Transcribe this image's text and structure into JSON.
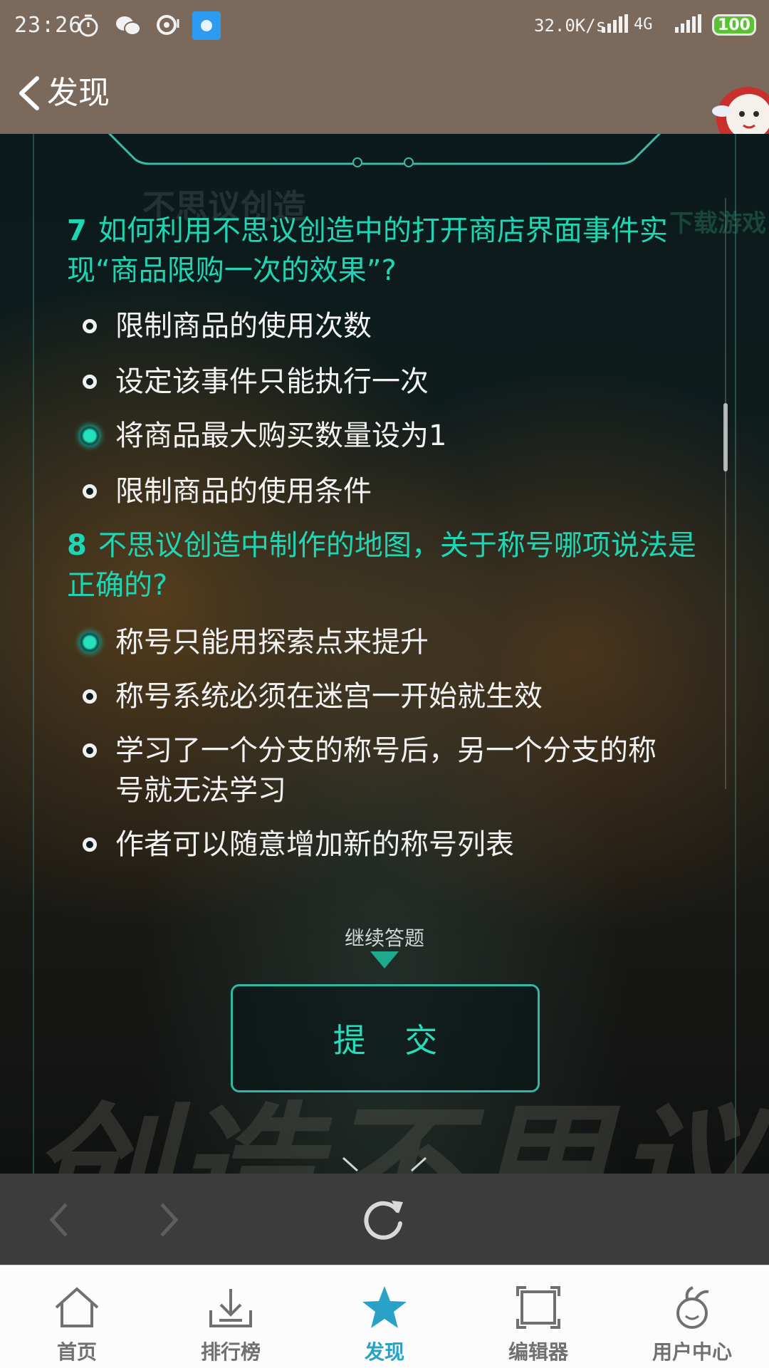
{
  "status_bar": {
    "time": "23:26",
    "net_speed": "32.0K/s",
    "network_type": "4G",
    "battery": "100",
    "icons": [
      "alarm-icon",
      "wechat-icon",
      "chat-bubble-icon",
      "app-notification-icon",
      "signal-icon",
      "battery-icon"
    ]
  },
  "header": {
    "back_icon": "chevron-left-icon",
    "title": "发现"
  },
  "questions": [
    {
      "number": "7",
      "text": "如何利用不思议创造中的打开商店界面事件实现“商品限购一次的效果”?",
      "options": [
        {
          "label": "限制商品的使用次数",
          "selected": false
        },
        {
          "label": "设定该事件只能执行一次",
          "selected": false
        },
        {
          "label": "将商品最大购买数量设为1",
          "selected": true
        },
        {
          "label": "限制商品的使用条件",
          "selected": false
        }
      ]
    },
    {
      "number": "8",
      "text": "不思议创造中制作的地图，关于称号哪项说法是正确的?",
      "options": [
        {
          "label": "称号只能用探索点来提升",
          "selected": true
        },
        {
          "label": "称号系统必须在迷宫一开始就生效",
          "selected": false
        },
        {
          "label": "学习了一个分支的称号后，另一个分支的称号就无法学习",
          "selected": false
        },
        {
          "label": "作者可以随意增加新的称号列表",
          "selected": false
        }
      ]
    }
  ],
  "continue_label": "继续答题",
  "submit_label": "提 交",
  "background_text": {
    "game_name": "不思议创造",
    "download": "下载游戏",
    "banner": "创造不思议"
  },
  "browser_bar": {
    "back_icon": "back-arrow-icon",
    "forward_icon": "forward-arrow-icon",
    "refresh_icon": "refresh-icon"
  },
  "tabs": [
    {
      "label": "首页",
      "icon": "home-icon",
      "active": false
    },
    {
      "label": "排行榜",
      "icon": "download-icon",
      "active": false
    },
    {
      "label": "发现",
      "icon": "star-icon",
      "active": true
    },
    {
      "label": "编辑器",
      "icon": "editor-frame-icon",
      "active": false
    },
    {
      "label": "用户中心",
      "icon": "user-center-icon",
      "active": false
    }
  ],
  "colors": {
    "accent": "#1fd6b4",
    "header_bg": "#7b6a5c",
    "tab_active": "#2aa2c8"
  }
}
